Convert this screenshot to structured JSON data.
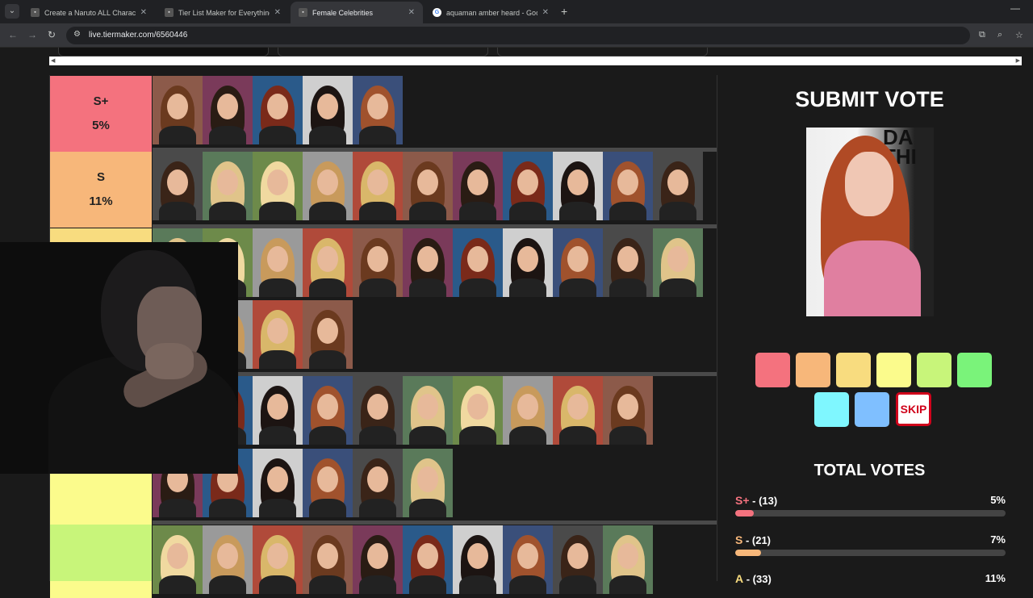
{
  "browser": {
    "tabs": [
      {
        "title": "Create a Naruto ALL Character",
        "active": false
      },
      {
        "title": "Tier List Maker for Everything -",
        "active": false
      },
      {
        "title": "Female Celebrities",
        "active": true
      },
      {
        "title": "aquaman amber heard - Googl",
        "active": false
      }
    ],
    "url": "live.tiermaker.com/6560446"
  },
  "tiers": [
    {
      "name": "S+",
      "percent": "5%",
      "color": "#f4727e",
      "count": 5
    },
    {
      "name": "S",
      "percent": "11%",
      "color": "#f7b77a",
      "count": 11
    },
    {
      "name": "",
      "percent": "",
      "color": "#f8dc7f",
      "count": 15
    },
    {
      "name": "",
      "percent": "",
      "color": "#f8dc7f",
      "count": 10
    },
    {
      "name": "",
      "percent": "",
      "color": "#fbfb8c",
      "count": 6
    },
    {
      "name": "",
      "percent": "",
      "color": "#c8f57a",
      "count": 10
    }
  ],
  "vote": {
    "title": "SUBMIT VOTE",
    "image_text": "DA\nTHI",
    "button_colors": [
      "#f4727e",
      "#f7b77a",
      "#f8dc7f",
      "#fbfb8c",
      "#c8f57a",
      "#7af37a",
      "#7ff7ff",
      "#7fbfff"
    ],
    "skip_label": "SKIP"
  },
  "totals": {
    "title": "TOTAL VOTES",
    "rows": [
      {
        "tier": "S+",
        "count": " - (13)",
        "percent": "5%",
        "color": "#f4727e",
        "fraction": 0.05
      },
      {
        "tier": "S",
        "count": " - (21)",
        "percent": "7%",
        "color": "#f7b77a",
        "fraction": 0.07
      },
      {
        "tier": "A",
        "count": " - (33)",
        "percent": "11%",
        "color": "#f8dc7f",
        "fraction": 0.11
      }
    ]
  }
}
